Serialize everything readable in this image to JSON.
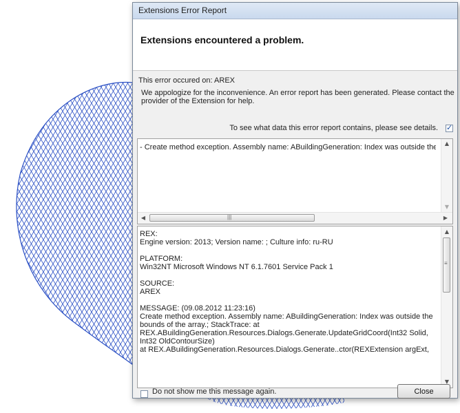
{
  "window": {
    "title": "Extensions Error Report"
  },
  "header": {
    "title": "Extensions encountered a problem."
  },
  "error_source": "This error occured on: AREX",
  "apology": "We appologize for the inconvenience. An error report has been generated.  Please contact the provider of the Extension for help.",
  "details": {
    "prompt": "To see what data this error report contains, please see details.",
    "checked": true
  },
  "exception_line": "- Create method exception. Assembly name: ABuildingGeneration: Index was outside the b",
  "report": {
    "rex": [
      "REX:",
      "Engine version: 2013; Version name: ; Culture info: ru-RU"
    ],
    "platform": [
      "PLATFORM:",
      "Win32NT Microsoft Windows NT 6.1.7601 Service Pack 1"
    ],
    "source": [
      "SOURCE:",
      "AREX"
    ],
    "message": [
      "MESSAGE: (09.08.2012 11:23:16)",
      "Create method exception. Assembly name: ABuildingGeneration: Index was outside the bounds of the array.; StackTrace:    at REX.ABuildingGeneration.Resources.Dialogs.Generate.UpdateGridCoord(Int32 Solid, Int32 OldContourSize)",
      "   at REX.ABuildingGeneration.Resources.Dialogs.Generate..ctor(REXExtension argExt,"
    ]
  },
  "footer": {
    "dont_show_label": "Do not show me this message again.",
    "dont_show_checked": false,
    "close_label": "Close"
  },
  "icons": [
    "check-icon",
    "arrow-left-icon",
    "arrow-right-icon",
    "arrow-up-icon",
    "arrow-down-icon",
    "scroll-grip-icon"
  ],
  "colors": {
    "wireframe": "#2a4fc4",
    "title_bar": "#c9d9ee",
    "check": "#1d4fa3"
  }
}
